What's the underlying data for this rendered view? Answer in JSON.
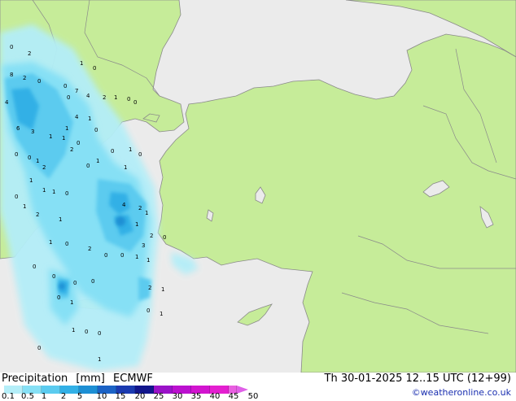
{
  "legend": {
    "label_parts": [
      "Precipitation",
      "[mm]",
      "ECMWF"
    ],
    "title": "Precipitation [mm] ECMWF",
    "ticks": [
      "0.1",
      "0.5",
      "1",
      "2",
      "5",
      "10",
      "15",
      "20",
      "25",
      "30",
      "35",
      "40",
      "45",
      "50"
    ],
    "colors": [
      "#b4eef8",
      "#86e0f5",
      "#5bcbef",
      "#32b0e6",
      "#1d8fd4",
      "#1b62c5",
      "#1b3ab0",
      "#12168c",
      "#9a12c8",
      "#bb10cf",
      "#d214cf",
      "#e41fd0",
      "#e85fe0"
    ]
  },
  "timestamp": "Th 30-01-2025 12..15 UTC (12+99)",
  "credit": "©weatheronline.co.uk",
  "map": {
    "land_color": "#c6ec99",
    "outside_color": "#ebebeb",
    "sea_color": "#ebebeb",
    "border_color": "#8a8a8a",
    "value_labels": [
      "2",
      "0",
      "0",
      "1",
      "0",
      "0",
      "8",
      "2",
      "0",
      "7",
      "4",
      "2",
      "1",
      "0",
      "0",
      "4",
      "4",
      "1",
      "1",
      "0",
      "0",
      "6",
      "3",
      "1",
      "1",
      "2",
      "0",
      "0",
      "1",
      "2",
      "0",
      "1",
      "0",
      "1",
      "0",
      "1",
      "1",
      "1",
      "1",
      "0",
      "2",
      "1",
      "4",
      "2",
      "1",
      "0",
      "1",
      "1",
      "0",
      "2",
      "0",
      "0",
      "1",
      "1",
      "0",
      "0",
      "0",
      "0",
      "2",
      "0",
      "3",
      "1",
      "2",
      "1",
      "0",
      "1",
      "0",
      "1",
      "1",
      "0",
      "0",
      "0",
      "1"
    ]
  }
}
